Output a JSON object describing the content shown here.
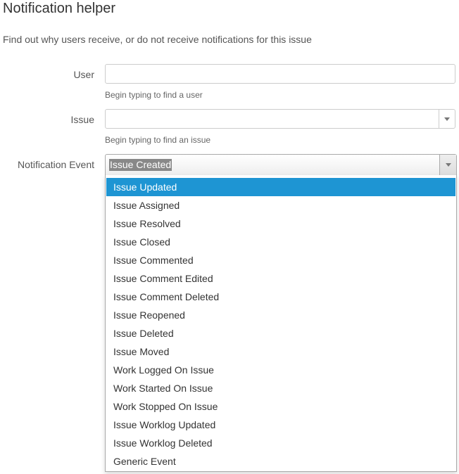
{
  "header": {
    "title": "Notification helper",
    "description": "Find out why users receive, or do not receive notifications for this issue"
  },
  "form": {
    "user": {
      "label": "User",
      "value": "",
      "hint": "Begin typing to find a user"
    },
    "issue": {
      "label": "Issue",
      "value": "",
      "hint": "Begin typing to find an issue",
      "icon": "chevron-down-icon"
    },
    "event": {
      "label": "Notification Event",
      "selected": "Issue Created",
      "icon": "chevron-down-icon",
      "options": [
        "Issue Updated",
        "Issue Assigned",
        "Issue Resolved",
        "Issue Closed",
        "Issue Commented",
        "Issue Comment Edited",
        "Issue Comment Deleted",
        "Issue Reopened",
        "Issue Deleted",
        "Issue Moved",
        "Work Logged On Issue",
        "Work Started On Issue",
        "Work Stopped On Issue",
        "Issue Worklog Updated",
        "Issue Worklog Deleted",
        "Generic Event"
      ],
      "highlighted_index": 0
    }
  },
  "colors": {
    "highlight": "#1e95d3",
    "text": "#333333",
    "muted": "#555555"
  }
}
